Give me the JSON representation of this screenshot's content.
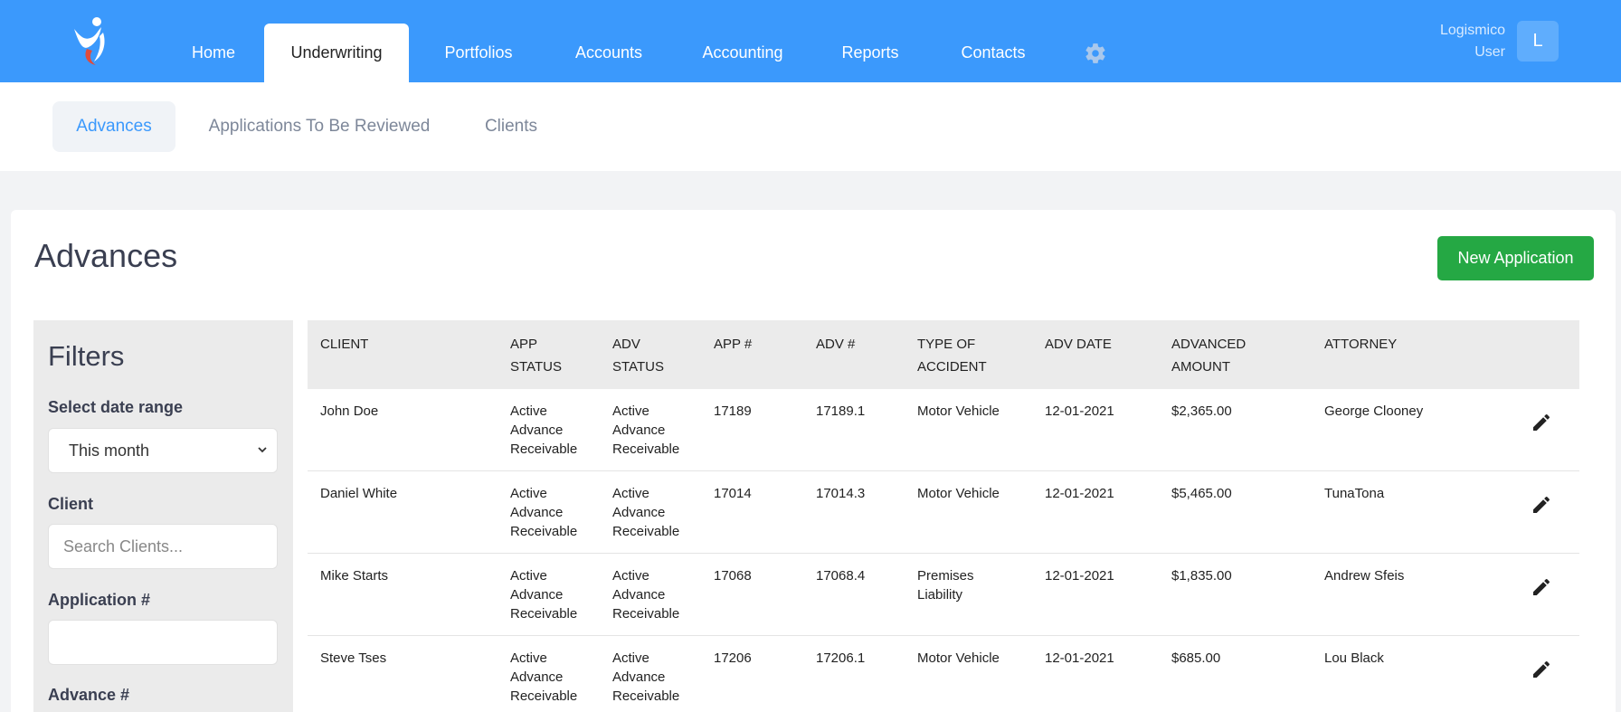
{
  "nav": {
    "items": [
      "Home",
      "Underwriting",
      "Portfolios",
      "Accounts",
      "Accounting",
      "Reports",
      "Contacts"
    ],
    "active": "Underwriting"
  },
  "user": {
    "line1": "Logismico",
    "line2": "User",
    "initial": "L"
  },
  "subtabs": [
    "Advances",
    "Applications To Be Reviewed",
    "Clients"
  ],
  "page": {
    "title": "Advances",
    "new_button": "New Application"
  },
  "filters": {
    "title": "Filters",
    "date_range_label": "Select date range",
    "date_range_value": "This month",
    "client_label": "Client",
    "client_placeholder": "Search Clients...",
    "application_label": "Application #",
    "advance_label": "Advance #"
  },
  "table": {
    "headers": [
      [
        "CLIENT"
      ],
      [
        "APP",
        "STATUS"
      ],
      [
        "ADV",
        "STATUS"
      ],
      [
        "APP #"
      ],
      [
        "ADV #"
      ],
      [
        "TYPE OF",
        "ACCIDENT"
      ],
      [
        "ADV DATE"
      ],
      [
        "ADVANCED",
        "AMOUNT"
      ],
      [
        "ATTORNEY"
      ]
    ],
    "rows": [
      {
        "client": "John Doe",
        "app_status": [
          "Active",
          "Advance",
          "Receivable"
        ],
        "adv_status": [
          "Active",
          "Advance",
          "Receivable"
        ],
        "app_no": "17189",
        "adv_no": "17189.1",
        "accident": [
          "Motor Vehicle"
        ],
        "adv_date": "12-01-2021",
        "amount": "$2,365.00",
        "attorney": "George Clooney"
      },
      {
        "client": "Daniel White",
        "app_status": [
          "Active",
          "Advance",
          "Receivable"
        ],
        "adv_status": [
          "Active",
          "Advance",
          "Receivable"
        ],
        "app_no": "17014",
        "adv_no": "17014.3",
        "accident": [
          "Motor Vehicle"
        ],
        "adv_date": "12-01-2021",
        "amount": "$5,465.00",
        "attorney": "TunaTona"
      },
      {
        "client": "Mike Starts",
        "app_status": [
          "Active",
          "Advance",
          "Receivable"
        ],
        "adv_status": [
          "Active",
          "Advance",
          "Receivable"
        ],
        "app_no": "17068",
        "adv_no": "17068.4",
        "accident": [
          "Premises",
          "Liability"
        ],
        "adv_date": "12-01-2021",
        "amount": "$1,835.00",
        "attorney": "Andrew Sfeis"
      },
      {
        "client": "Steve Tses",
        "app_status": [
          "Active",
          "Advance",
          "Receivable"
        ],
        "adv_status": [
          "Active",
          "Advance",
          "Receivable"
        ],
        "app_no": "17206",
        "adv_no": "17206.1",
        "accident": [
          "Motor Vehicle"
        ],
        "adv_date": "12-01-2021",
        "amount": "$685.00",
        "attorney": "Lou Black"
      }
    ]
  },
  "colors": {
    "brand": "#3b99fc",
    "success": "#25a844",
    "accent_text": "#3b99fc"
  },
  "icons": {
    "logo": "person-swoosh-logo",
    "settings": "gear-icon",
    "edit": "pencil-icon",
    "select": "chevron-down-icon"
  }
}
